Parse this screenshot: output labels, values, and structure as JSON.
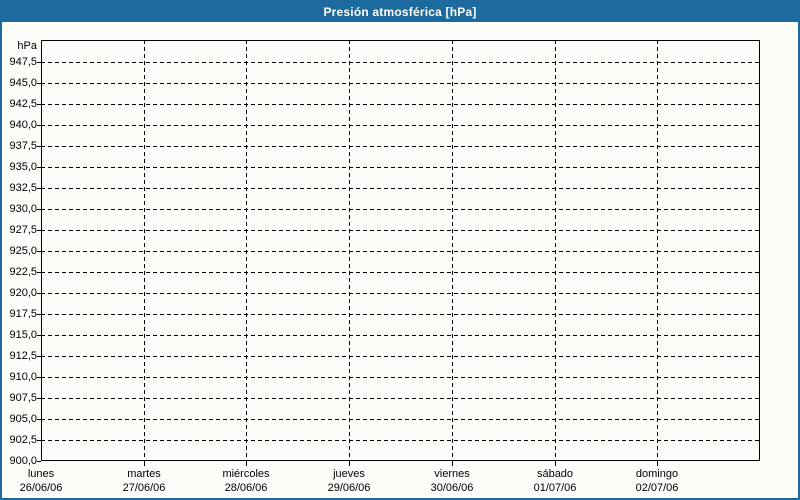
{
  "window": {
    "title": "Presión atmosférica [hPa]"
  },
  "colors": {
    "titlebar_bg": "#1d6b9e",
    "titlebar_text": "#ffffff",
    "frame_border": "#1d6b9e",
    "background": "#fcfdf8",
    "grid_color": "#000000",
    "text_color": "#000000"
  },
  "chart_data": {
    "type": "line",
    "title": "Presión atmosférica [hPa]",
    "xlabel": "",
    "ylabel": "hPa",
    "ylim": [
      900,
      950
    ],
    "ytick_step": 2.5,
    "ytick_labels": [
      "947,5",
      "945,0",
      "942,5",
      "940,0",
      "937,5",
      "935,0",
      "932,5",
      "930,0",
      "927,5",
      "925,0",
      "922,5",
      "920,0",
      "917,5",
      "915,0",
      "912,5",
      "910,0",
      "907,5",
      "905,0",
      "902,5",
      "900,0"
    ],
    "categories": [
      "lunes",
      "martes",
      "miércoles",
      "jueves",
      "viernes",
      "sábado",
      "domingo"
    ],
    "category_dates": [
      "26/06/06",
      "27/06/06",
      "28/06/06",
      "29/06/06",
      "30/06/06",
      "01/07/06",
      "02/07/06"
    ],
    "series": [],
    "grid": "dashed",
    "legend": "none"
  }
}
